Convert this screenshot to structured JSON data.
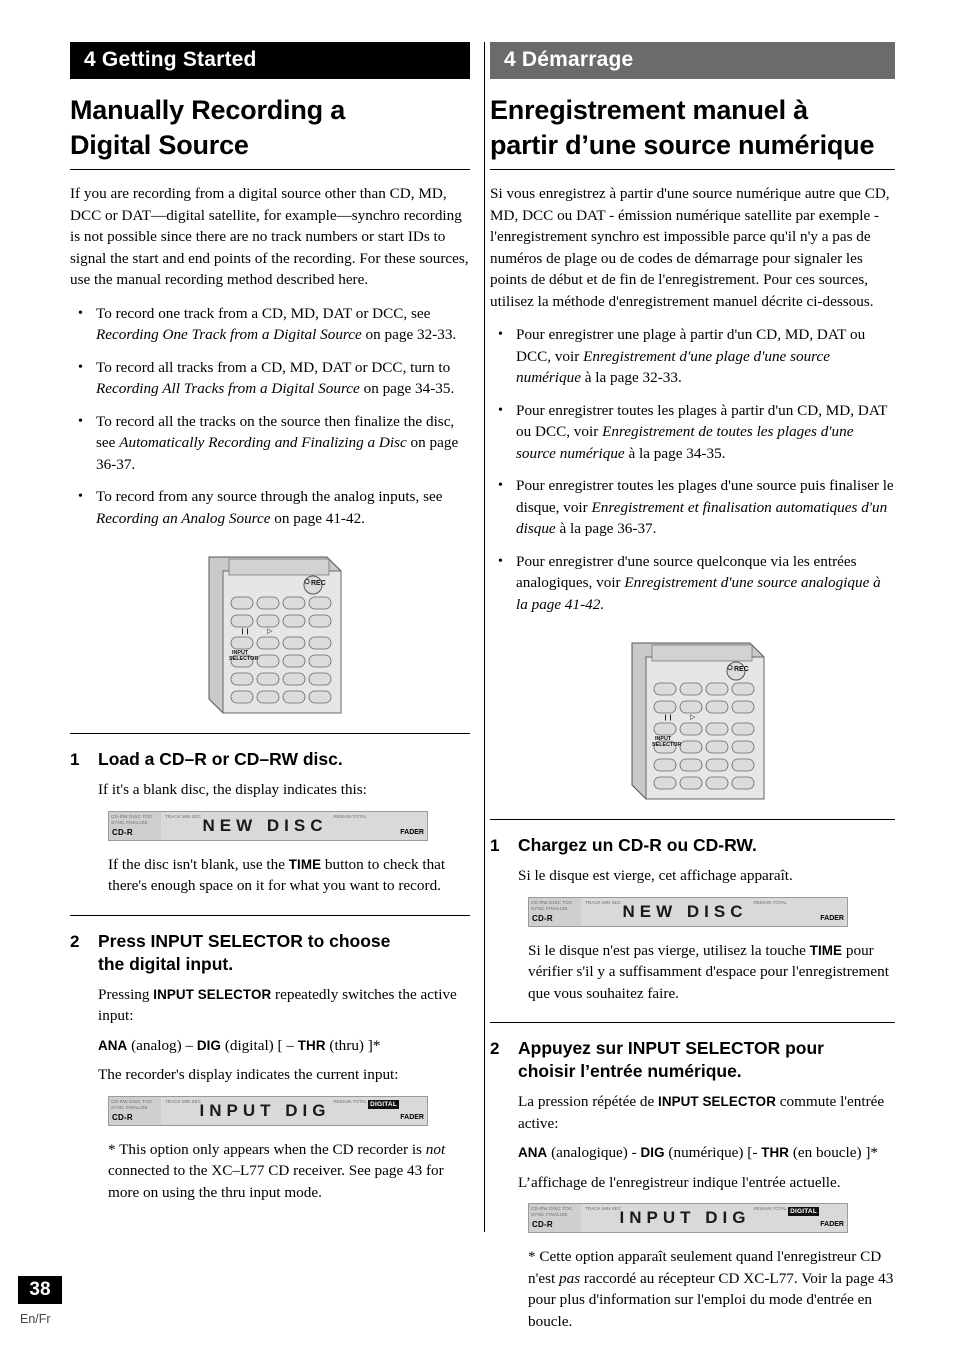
{
  "left": {
    "chapter": "4 Getting Started",
    "title_line1": "Manually Recording a",
    "title_line2": "Digital Source",
    "intro": "If you are recording from a digital source other than CD, MD, DCC or DAT—digital satellite, for example—synchro recording is not possible since there are no track numbers or start IDs to signal the start and end points of the recording. For these sources, use the manual recording method described here.",
    "bullets": [
      {
        "pre": "To record one track from a CD, MD, DAT or DCC, see ",
        "italic": "Recording One Track from a Digital Source",
        "post": " on page 32-33."
      },
      {
        "pre": "To record all tracks from a CD, MD, DAT or DCC, turn to ",
        "italic": "Recording All Tracks from a Digital Source",
        "post": " on page 34-35."
      },
      {
        "pre": "To record all the tracks on the source then finalize the disc, see ",
        "italic": "Automatically Recording and Finalizing a Disc",
        "post": " on page 36-37."
      },
      {
        "pre": "To record from any source through the analog inputs, see ",
        "italic": "Recording an Analog Source",
        "post": " on page 41-42."
      }
    ],
    "step1": {
      "num": "1",
      "title": "Load a CD–R or CD–RW disc.",
      "p1": "If it's a blank disc, the display indicates this:",
      "lcd_text": "NEW DISC",
      "p2_pre": "If the disc isn't blank, use the ",
      "p2_bold": "TIME",
      "p2_post": " button to check that there's enough space on it for what you want to record."
    },
    "step2": {
      "num": "2",
      "title_line1": "Press INPUT SELECTOR to choose",
      "title_line2": "the digital input.",
      "p1_pre": "Pressing ",
      "p1_bold": "INPUT SELECTOR",
      "p1_post": " repeatedly switches the active input:",
      "modes": [
        {
          "bold": "ANA",
          "plain": " (analog) – "
        },
        {
          "bold": "DIG",
          "plain": " (digital) [ – "
        },
        {
          "bold": "THR",
          "plain": " (thru) ]*"
        }
      ],
      "p2": "The recorder's display indicates the current input:",
      "lcd_text": "INPUT DIG",
      "footnote_pre": "* This option only appears when the CD recorder is ",
      "footnote_italic": "not",
      "footnote_post": " connected to the XC–L77 CD receiver. See page 43 for more on using the thru input mode."
    }
  },
  "right": {
    "chapter": "4 Démarrage",
    "title_line1": "Enregistrement manuel à",
    "title_line2": "partir d’une source numérique",
    "intro": "Si vous enregistrez à partir d'une source numérique autre que CD, MD, DCC ou DAT - émission numérique satellite par exemple - l'enregistrement synchro est impossible parce qu'il n'y a pas de numéros de plage ou de codes de démarrage pour signaler les points de début et de fin de l'enregistrement. Pour ces sources, utilisez la méthode d'enregistrement manuel décrite ci-dessous.",
    "bullets": [
      {
        "pre": "Pour enregistrer une plage à partir d'un CD, MD, DAT ou DCC, voir ",
        "italic": "Enregistrement d'une plage d'une source numérique",
        "post": " à la page 32-33."
      },
      {
        "pre": "Pour enregistrer toutes les plages à partir d'un CD, MD, DAT ou DCC, voir ",
        "italic": "Enregistrement de toutes les plages d'une source numérique",
        "post": " à la page 34-35."
      },
      {
        "pre": "Pour enregistrer toutes les plages d'une source puis finaliser le disque, voir ",
        "italic": "Enregistrement et finalisation automatiques d'un disque",
        "post": " à la page 36-37."
      },
      {
        "pre": "Pour enregistrer d'une source quelconque via les entrées analogiques, voir ",
        "italic": "Enregistrement d'une source analogique à la page 41-42.",
        "post": ""
      }
    ],
    "step1": {
      "num": "1",
      "title": "Chargez un CD-R ou CD-RW.",
      "p1": "Si le disque est vierge, cet affichage apparaît.",
      "lcd_text": "NEW DISC",
      "p2_pre": "Si le disque n'est pas vierge, utilisez la touche ",
      "p2_bold": "TIME",
      "p2_post": " pour vérifier s'il y a suffisamment d'espace pour l'enregistrement que vous souhaitez faire."
    },
    "step2": {
      "num": "2",
      "title_line1": "Appuyez sur INPUT SELECTOR pour",
      "title_line2": "choisir l’entrée numérique.",
      "p1_pre": "La pression répétée de ",
      "p1_bold": "INPUT SELECTOR",
      "p1_post": " commute l'entrée active:",
      "modes": [
        {
          "bold": "ANA",
          "plain": " (analogique) - "
        },
        {
          "bold": "DIG",
          "plain": " (numérique) [- "
        },
        {
          "bold": "THR",
          "plain": " (en boucle) ]*"
        }
      ],
      "p2": "L’affichage de l'enregistreur indique l'entrée actuelle.",
      "lcd_text": "INPUT DIG",
      "footnote_pre": "* Cette option apparaît seulement quand l'enregistreur CD n'est ",
      "footnote_italic": "pas",
      "footnote_post": " raccordé au récepteur CD XC-L77. Voir la page 43 pour plus d'information sur l'emploi du mode d'entrée en boucle."
    }
  },
  "remote": {
    "rec_label": "REC",
    "input_label_line1": "INPUT",
    "input_label_line2": "SELECTOR",
    "pause_glyph": "❙❙",
    "play_glyph": "▷"
  },
  "lcd_chrome": {
    "cdr": "CD-R",
    "digital": "DIGITAL",
    "fader": "FADER",
    "micro_left_1": "CD-RW DISC TOC",
    "micro_left_2": "SYNC FINALIZE",
    "micro_top_left": "TRACK  MIN  SEC",
    "micro_top_right": "REMAIN TOTAL"
  },
  "footer": {
    "page_number": "38",
    "lang": "En/Fr"
  }
}
